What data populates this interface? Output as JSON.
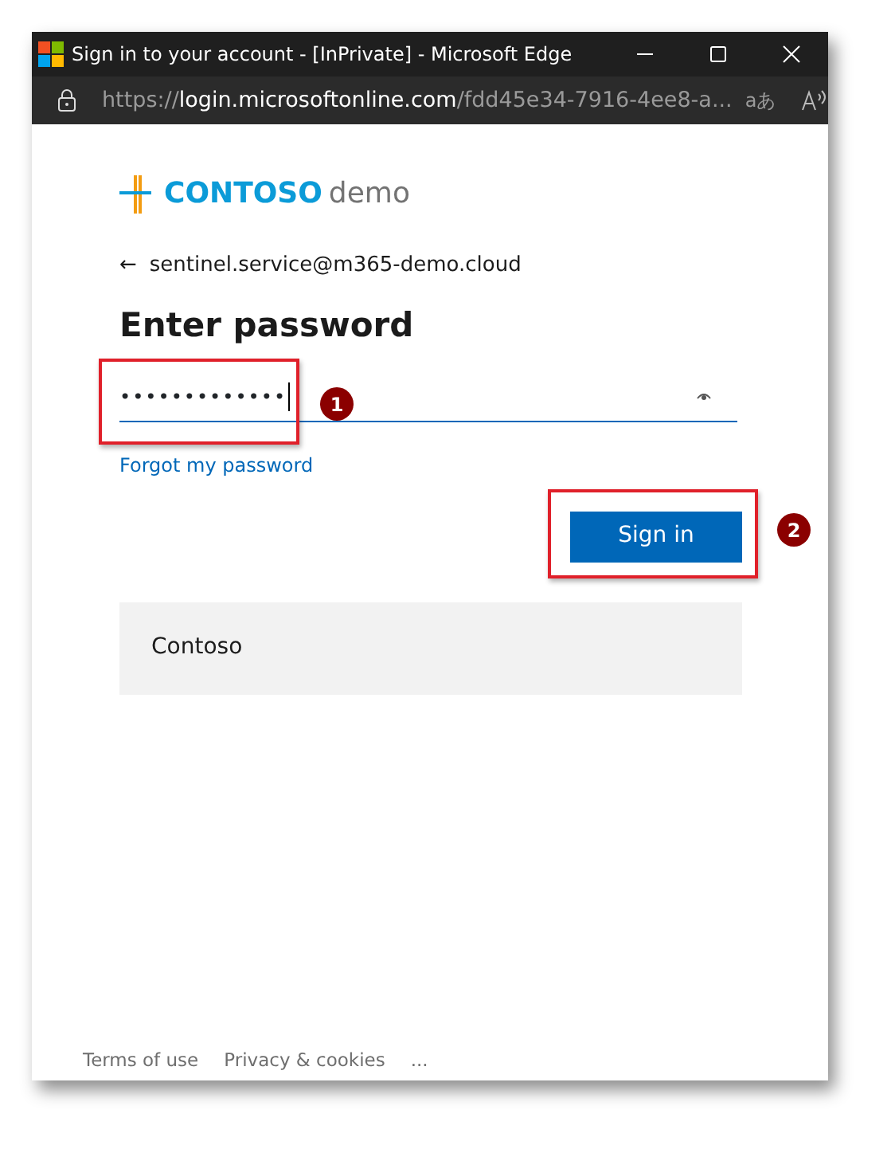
{
  "window": {
    "title": "Sign in to your account - [InPrivate] - Microsoft Edge"
  },
  "address_bar": {
    "scheme": "https://",
    "host": "login.microsoftonline.com",
    "path": "/fdd45e34-7916-4ee8-a...",
    "translate_label": "aあ"
  },
  "logo": {
    "brand": "CONTOSO",
    "suffix": "demo"
  },
  "back": {
    "arrow": "←",
    "account": "sentinel.service@m365-demo.cloud"
  },
  "heading": "Enter password",
  "password_field": {
    "value": "•••••••••••••"
  },
  "forgot_link": "Forgot my password",
  "sign_in_button": "Sign in",
  "tenant_panel": "Contoso",
  "footer": [
    "Terms of use",
    "Privacy & cookies",
    "..."
  ],
  "callouts": [
    {
      "number": "1"
    },
    {
      "number": "2"
    }
  ]
}
